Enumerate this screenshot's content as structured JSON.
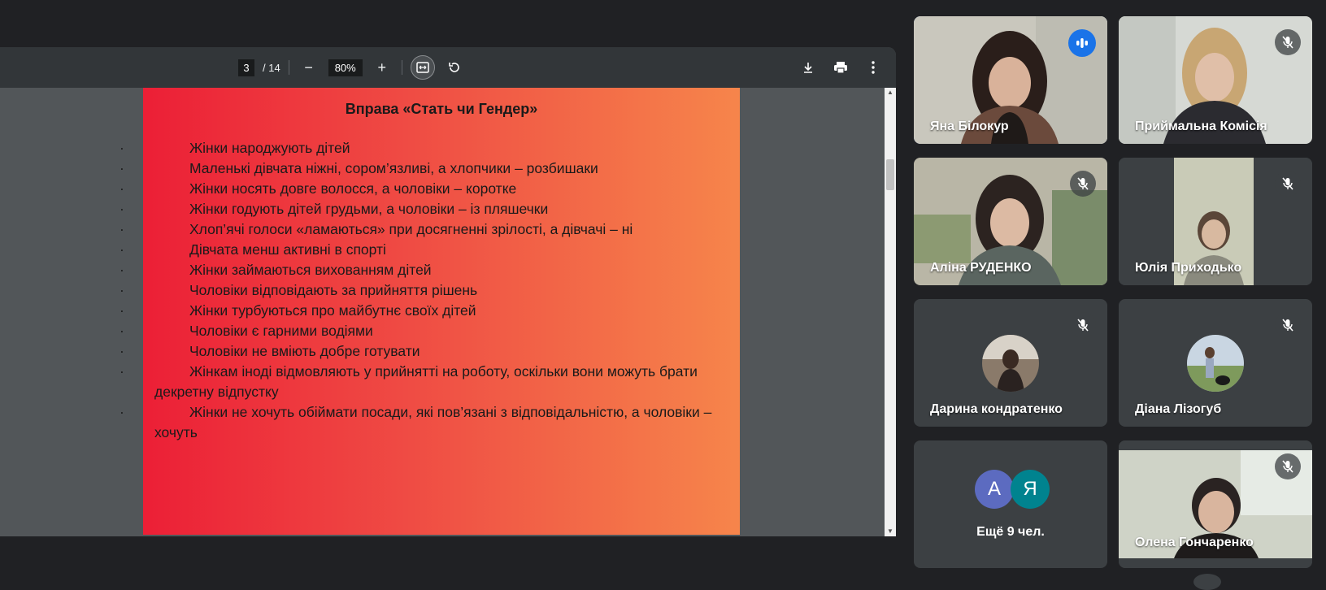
{
  "pdf": {
    "page_current": "3",
    "page_total": "/ 14",
    "zoom": "80%",
    "minus": "−",
    "plus": "+"
  },
  "slide": {
    "title": "Вправа «Стать чи Гендер»",
    "items": [
      "Жінки народжують дітей",
      "Маленькі дівчата ніжні, сором’язливі, а хлопчики – розбишаки",
      "Жінки носять довге волосся, а чоловіки – коротке",
      "Жінки годують дітей грудьми, а чоловіки – із пляшечки",
      "Хлоп’ячі голоси «ламаються» при досягненні зрілості, а дівчачі – ні",
      "Дівчата менш активні в спорті",
      "Жінки займаються вихованням дітей",
      "Чоловіки відповідають за прийняття рішень",
      "Жінки турбуються про майбутнє своїх дітей",
      "Чоловіки є гарними водіями",
      "Чоловіки не вміють добре готувати",
      "Жінкам іноді відмовляють у прийнятті на роботу, оскільки вони можуть брати декретну відпустку",
      "Жінки не хочуть обіймати посади, які пов’язані з відповідальністю, а чоловіки – хочуть"
    ]
  },
  "participants": [
    {
      "name": "Яна Білокур",
      "speaking": true
    },
    {
      "name": "Приймальна Комісія",
      "muted": true
    },
    {
      "name": "Аліна РУДЕНКО",
      "muted": true
    },
    {
      "name": "Юлія Приходько",
      "muted": true
    },
    {
      "name": "Дарина кондратенко",
      "muted": true
    },
    {
      "name": "Діана Лізогуб",
      "muted": true
    },
    {
      "name": "Олена Гончаренко",
      "muted": true
    }
  ],
  "more": {
    "label": "Ещё 9 чел.",
    "initial_a": "А",
    "initial_b": "Я"
  },
  "colors": {
    "active_outline": "#8ab4f8",
    "speaking": "#1a73e8",
    "avatar_a": "#5c6bc0",
    "avatar_b": "#00838f"
  }
}
